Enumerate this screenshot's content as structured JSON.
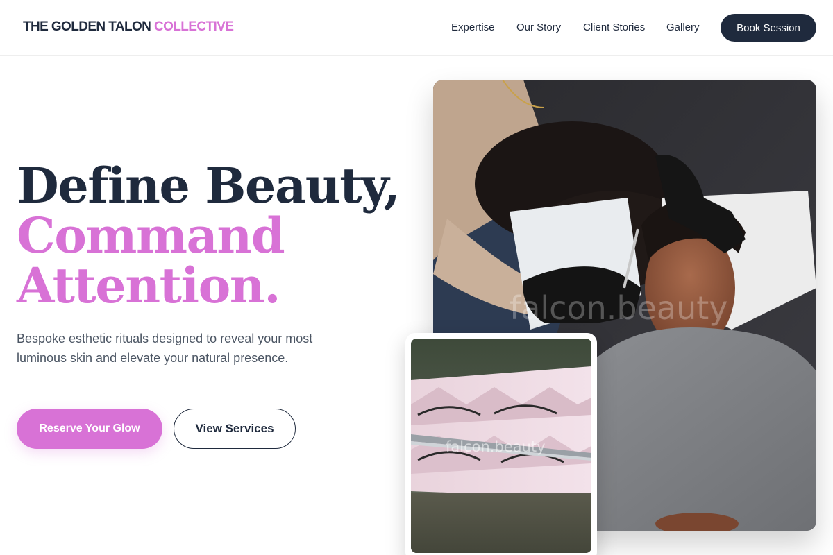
{
  "brand": {
    "name_main": "THE GOLDEN TALON ",
    "name_accent": "COLLECTIVE",
    "accent_color": "#d872d6",
    "primary_color": "#1f2a3d"
  },
  "nav": {
    "items": [
      {
        "label": "Expertise"
      },
      {
        "label": "Our Story"
      },
      {
        "label": "Client Stories"
      },
      {
        "label": "Gallery"
      }
    ],
    "cta_label": "Book Session"
  },
  "hero": {
    "headline_line1": "Define Beauty,",
    "headline_line2": "Command",
    "headline_line3": "Attention.",
    "subtext": "Bespoke esthetic rituals designed to reveal your most luminous skin and elevate your natural presence.",
    "primary_cta": "Reserve Your Glow",
    "secondary_cta": "View Services"
  },
  "images": {
    "main_watermark": "falcon.beauty",
    "inset_watermark": "falcon.beauty"
  }
}
